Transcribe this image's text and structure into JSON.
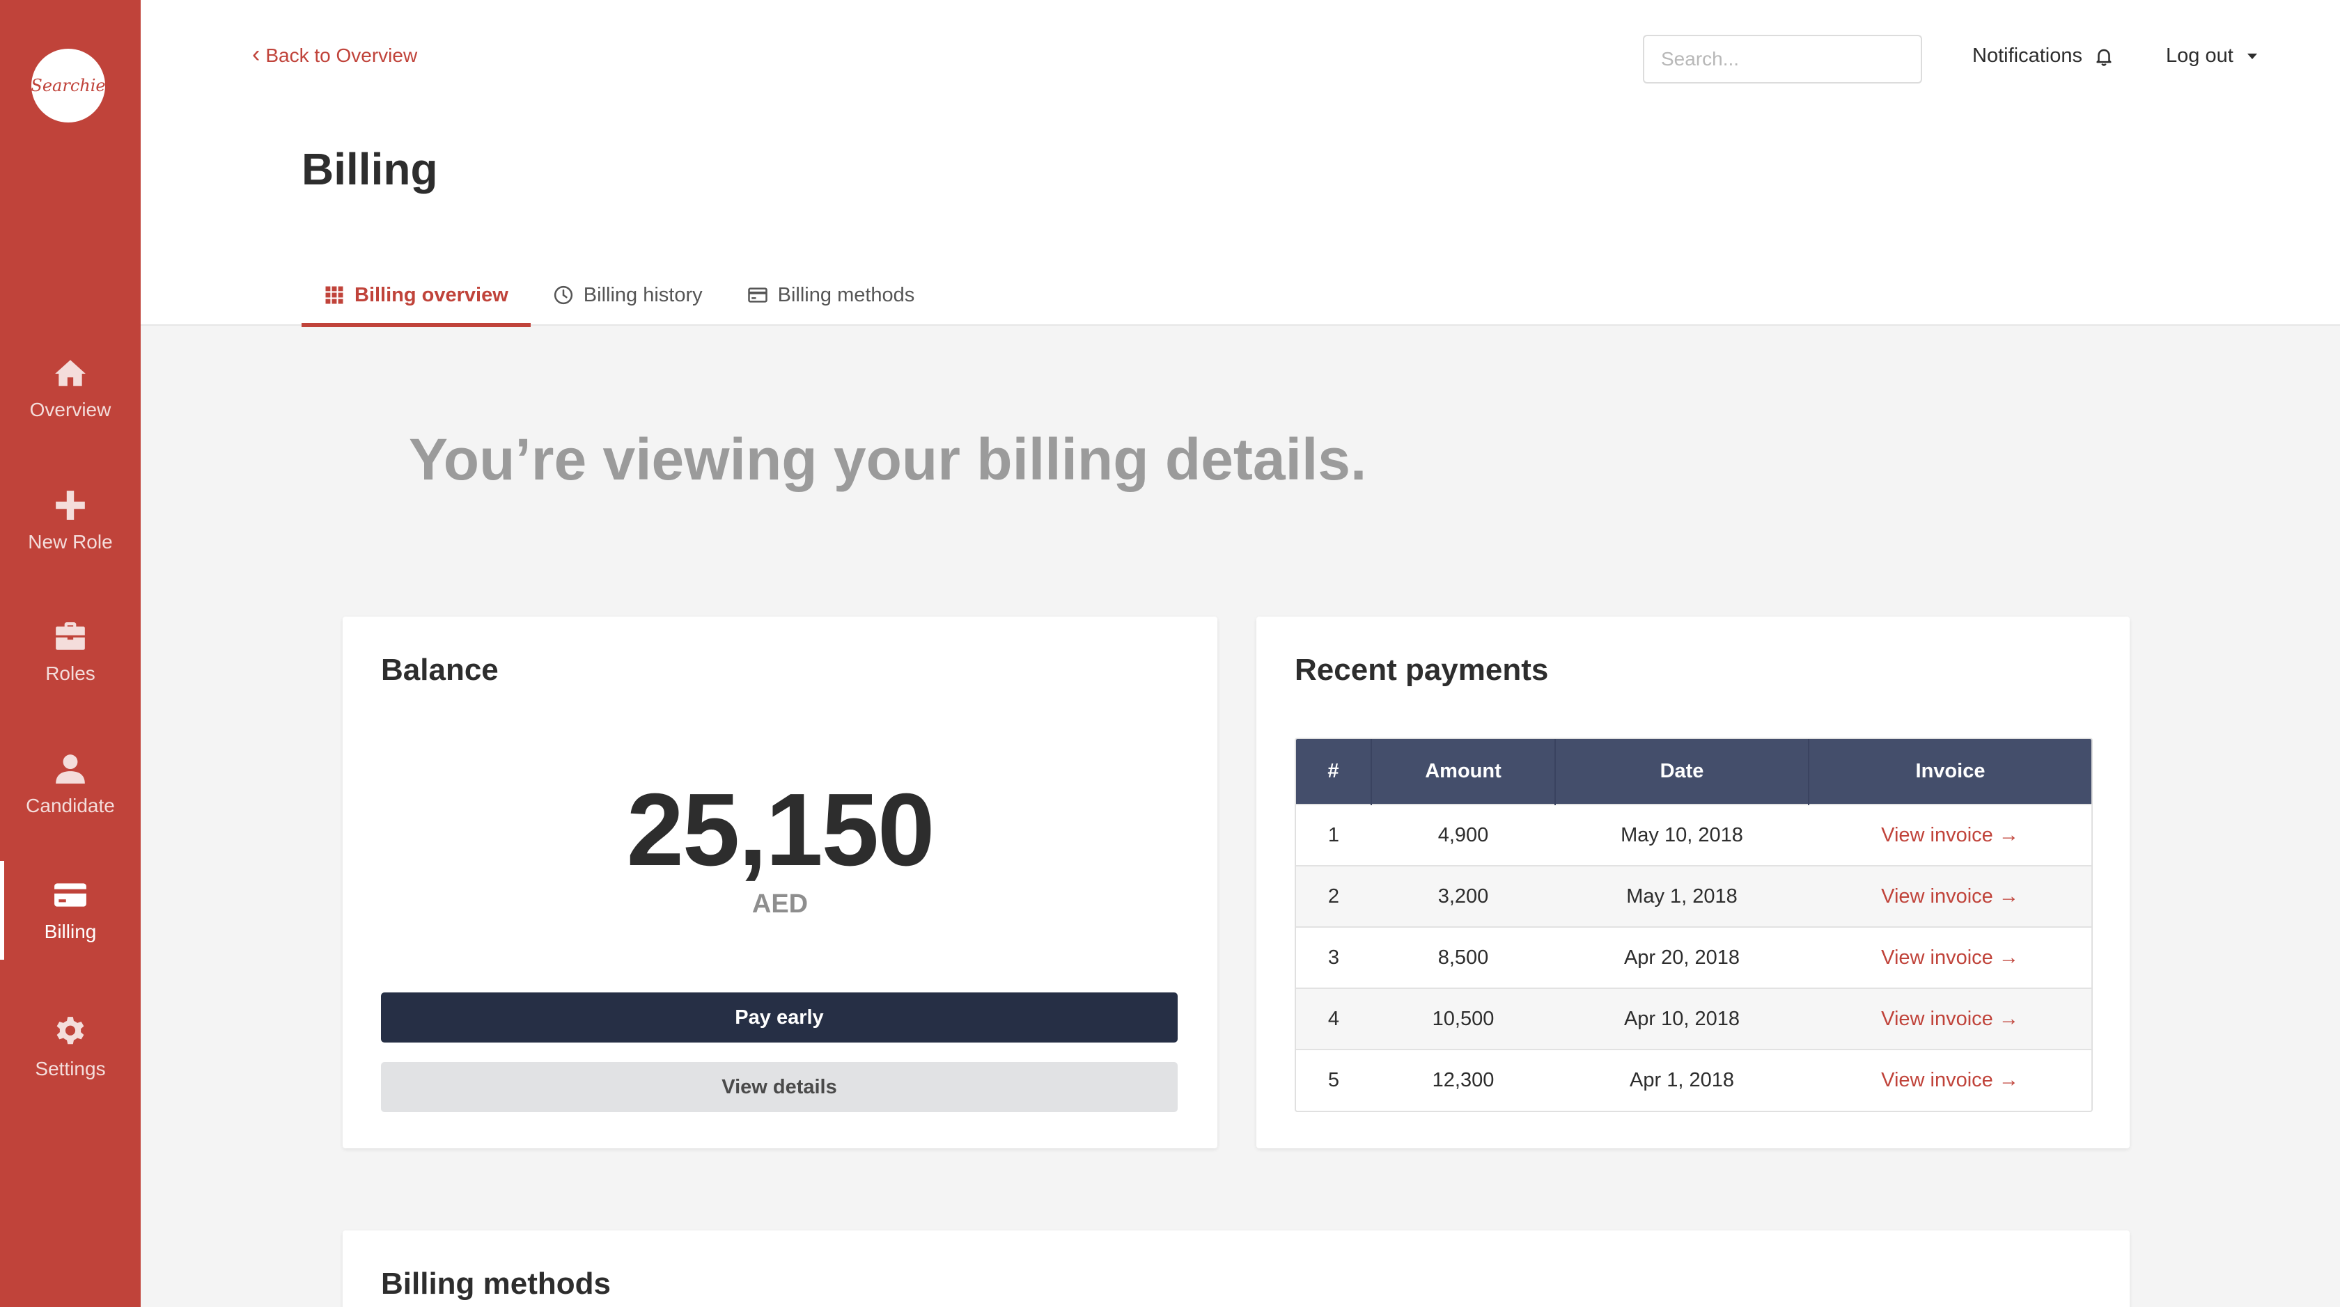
{
  "app": {
    "logo_text": "Searchie",
    "brand_color": "#c0433a",
    "navy_color": "#262f45"
  },
  "sidebar": {
    "items": [
      {
        "label": "Overview",
        "icon": "home-icon",
        "active": false
      },
      {
        "label": "New Role",
        "icon": "plus-icon",
        "active": false
      },
      {
        "label": "Roles",
        "icon": "briefcase-icon",
        "active": false
      },
      {
        "label": "Candidate",
        "icon": "user-icon",
        "active": false
      },
      {
        "label": "Billing",
        "icon": "credit-card-icon",
        "active": true
      },
      {
        "label": "Settings",
        "icon": "gear-icon",
        "active": false
      }
    ]
  },
  "header": {
    "back_label": "Back to Overview",
    "title": "Billing",
    "search_placeholder": "Search...",
    "notifications_label": "Notifications",
    "logout_label": "Log out",
    "tabs": [
      {
        "label": "Billing overview",
        "icon": "grid-icon",
        "active": true
      },
      {
        "label": "Billing history",
        "icon": "clock-icon",
        "active": false
      },
      {
        "label": "Billing methods",
        "icon": "credit-card-icon",
        "active": false
      }
    ]
  },
  "main": {
    "hero_text": "You’re viewing your billing details.",
    "balance": {
      "title": "Balance",
      "amount": "25,150",
      "currency": "AED",
      "pay_early_label": "Pay early",
      "view_details_label": "View details"
    },
    "payments": {
      "title": "Recent payments",
      "columns": [
        "#",
        "Amount",
        "Date",
        "Invoice"
      ],
      "rows": [
        {
          "num": "1",
          "amount": "4,900",
          "date": "May 10, 2018",
          "invoice": "View invoice →"
        },
        {
          "num": "2",
          "amount": "3,200",
          "date": "May 1, 2018",
          "invoice": "View invoice →"
        },
        {
          "num": "3",
          "amount": "8,500",
          "date": "Apr 20, 2018",
          "invoice": "View invoice →"
        },
        {
          "num": "4",
          "amount": "10,500",
          "date": "Apr 10, 2018",
          "invoice": "View invoice →"
        },
        {
          "num": "5",
          "amount": "12,300",
          "date": "Apr 1, 2018",
          "invoice": "View invoice →"
        }
      ]
    },
    "methods": {
      "title": "Billing methods"
    }
  }
}
